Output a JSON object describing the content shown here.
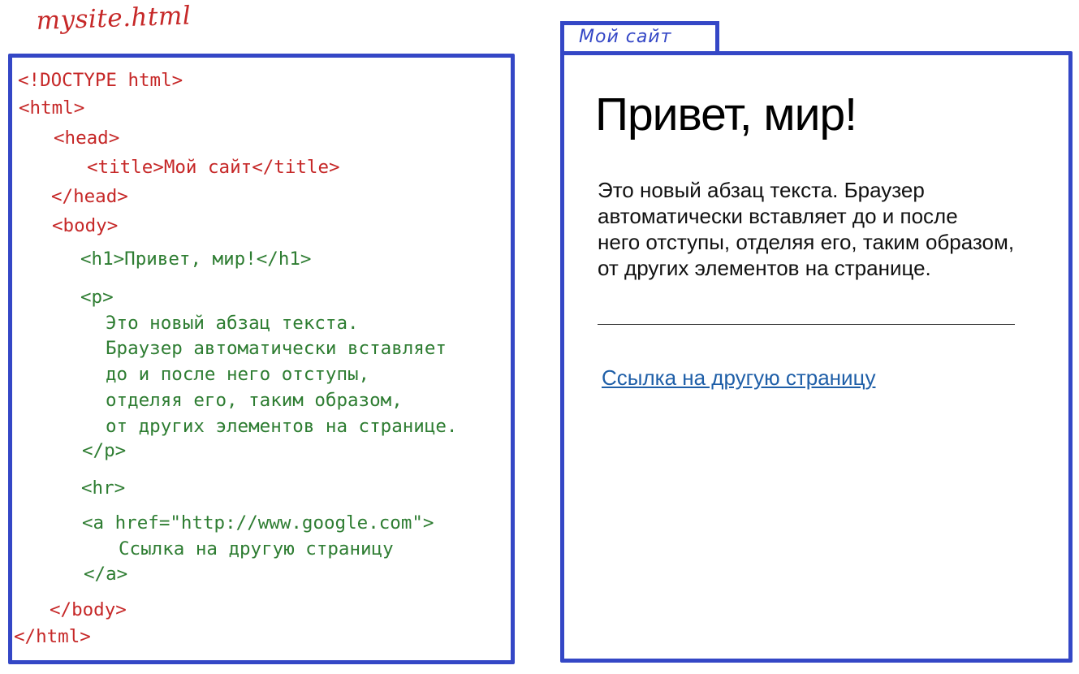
{
  "filename": "mysite.html",
  "code_lines": [
    {
      "text": "<!DOCTYPE html>",
      "color": "red"
    },
    {
      "text": "<html>",
      "color": "red"
    },
    {
      "text": "<head>",
      "color": "red"
    },
    {
      "text": "<title>Мой сайт</title>",
      "color": "red"
    },
    {
      "text": "</head>",
      "color": "red"
    },
    {
      "text": "<body>",
      "color": "red"
    },
    {
      "text": "<h1>Привет, мир!</h1>",
      "color": "green"
    },
    {
      "text": "<p>",
      "color": "green"
    },
    {
      "text": "Это новый абзац текста.",
      "color": "green"
    },
    {
      "text": "Браузер автоматически вставляет",
      "color": "green"
    },
    {
      "text": "до и после него отступы,",
      "color": "green"
    },
    {
      "text": "отделяя его, таким образом,",
      "color": "green"
    },
    {
      "text": "от других элементов на странице.",
      "color": "green"
    },
    {
      "text": "</p>",
      "color": "green"
    },
    {
      "text": "<hr>",
      "color": "green"
    },
    {
      "text": "<a href=\"http://www.google.com\">",
      "color": "green"
    },
    {
      "text": "Ссылка на другую страницу",
      "color": "green"
    },
    {
      "text": "</a>",
      "color": "green"
    },
    {
      "text": "</body>",
      "color": "red"
    },
    {
      "text": "</html>",
      "color": "red"
    }
  ],
  "browser": {
    "tab_title": "Мой сайт",
    "heading": "Привет, мир!",
    "paragraph_lines": [
      "Это новый абзац текста. Браузер",
      "автоматически вставляет до и после",
      "него отступы, отделяя его, таким образом,",
      "от других элементов на странице."
    ],
    "link_text": "Ссылка на другую страницу"
  },
  "colors": {
    "frame": "#3447c6",
    "code_tag": "#c62828",
    "code_content": "#2e7d32",
    "link": "#1f5fa8"
  }
}
